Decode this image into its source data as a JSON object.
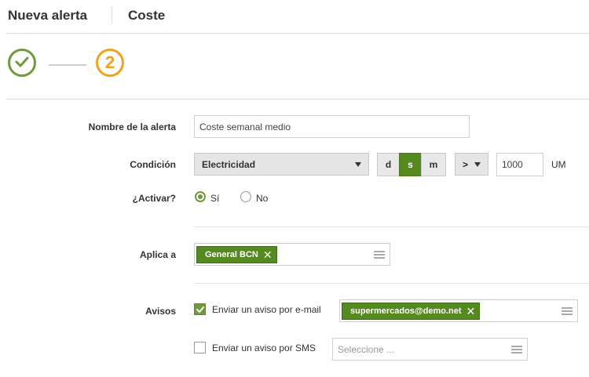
{
  "header": {
    "title": "Nueva alerta",
    "subtitle": "Coste"
  },
  "steps": {
    "current_number": "2"
  },
  "form": {
    "name": {
      "label": "Nombre de la alerta",
      "value": "Coste semanal medio"
    },
    "condition": {
      "label": "Condición",
      "metric": "Electricidad",
      "periods": [
        "d",
        "s",
        "m"
      ],
      "active_period": "s",
      "operator": ">",
      "threshold": "1000",
      "unit": "UM"
    },
    "activate": {
      "label": "¿Activar?",
      "options": [
        "Sí",
        "No"
      ],
      "selected": "Sí"
    },
    "applies_to": {
      "label": "Aplica a",
      "tags": [
        "General BCN"
      ]
    },
    "notices": {
      "label": "Avisos",
      "email": {
        "label": "Enviar un aviso por e-mail",
        "checked": true,
        "tags": [
          "supermercados@demo.net"
        ]
      },
      "sms": {
        "label": "Enviar un aviso por SMS",
        "checked": false,
        "placeholder": "Seleccione ..."
      }
    }
  },
  "colors": {
    "accent": "#558a21",
    "done": "#6e9b3a",
    "current": "#f3a11c"
  }
}
